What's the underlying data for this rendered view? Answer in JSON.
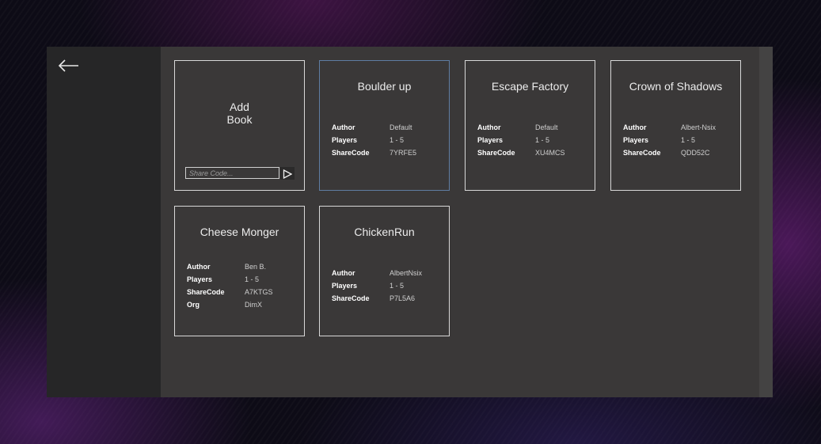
{
  "nav": {
    "back_icon": "arrow-left-icon"
  },
  "add_book": {
    "title_line1": "Add",
    "title_line2": "Book",
    "share_placeholder": "Share Code...",
    "submit_icon": "play-triangle-icon"
  },
  "books": [
    {
      "title": "Boulder up",
      "selected": true,
      "rows": [
        {
          "key": "Author",
          "value": "Default"
        },
        {
          "key": "Players",
          "value": "1 - 5"
        },
        {
          "key": "ShareCode",
          "value": "7YRFE5"
        }
      ]
    },
    {
      "title": "Escape Factory",
      "selected": false,
      "rows": [
        {
          "key": "Author",
          "value": "Default"
        },
        {
          "key": "Players",
          "value": "1 - 5"
        },
        {
          "key": "ShareCode",
          "value": "XU4MCS"
        }
      ]
    },
    {
      "title": "Crown of Shadows",
      "selected": false,
      "rows": [
        {
          "key": "Author",
          "value": "Albert-Nsix"
        },
        {
          "key": "Players",
          "value": "1 - 5"
        },
        {
          "key": "ShareCode",
          "value": "QDD52C"
        }
      ]
    },
    {
      "title": "Cheese Monger",
      "selected": false,
      "rows": [
        {
          "key": "Author",
          "value": "Ben B."
        },
        {
          "key": "Players",
          "value": "1 - 5"
        },
        {
          "key": "ShareCode",
          "value": "A7KTGS"
        },
        {
          "key": "Org",
          "value": "DimX"
        }
      ]
    },
    {
      "title": "ChickenRun",
      "selected": false,
      "rows": [
        {
          "key": "Author",
          "value": "AlbertNsix"
        },
        {
          "key": "Players",
          "value": "1 - 5"
        },
        {
          "key": "ShareCode",
          "value": "P7L5A6"
        }
      ]
    }
  ],
  "colors": {
    "window_bg": "#3a3838",
    "sidebar_bg": "#262627",
    "card_border": "#d8d8d8",
    "selected_border": "#5f7da3"
  }
}
